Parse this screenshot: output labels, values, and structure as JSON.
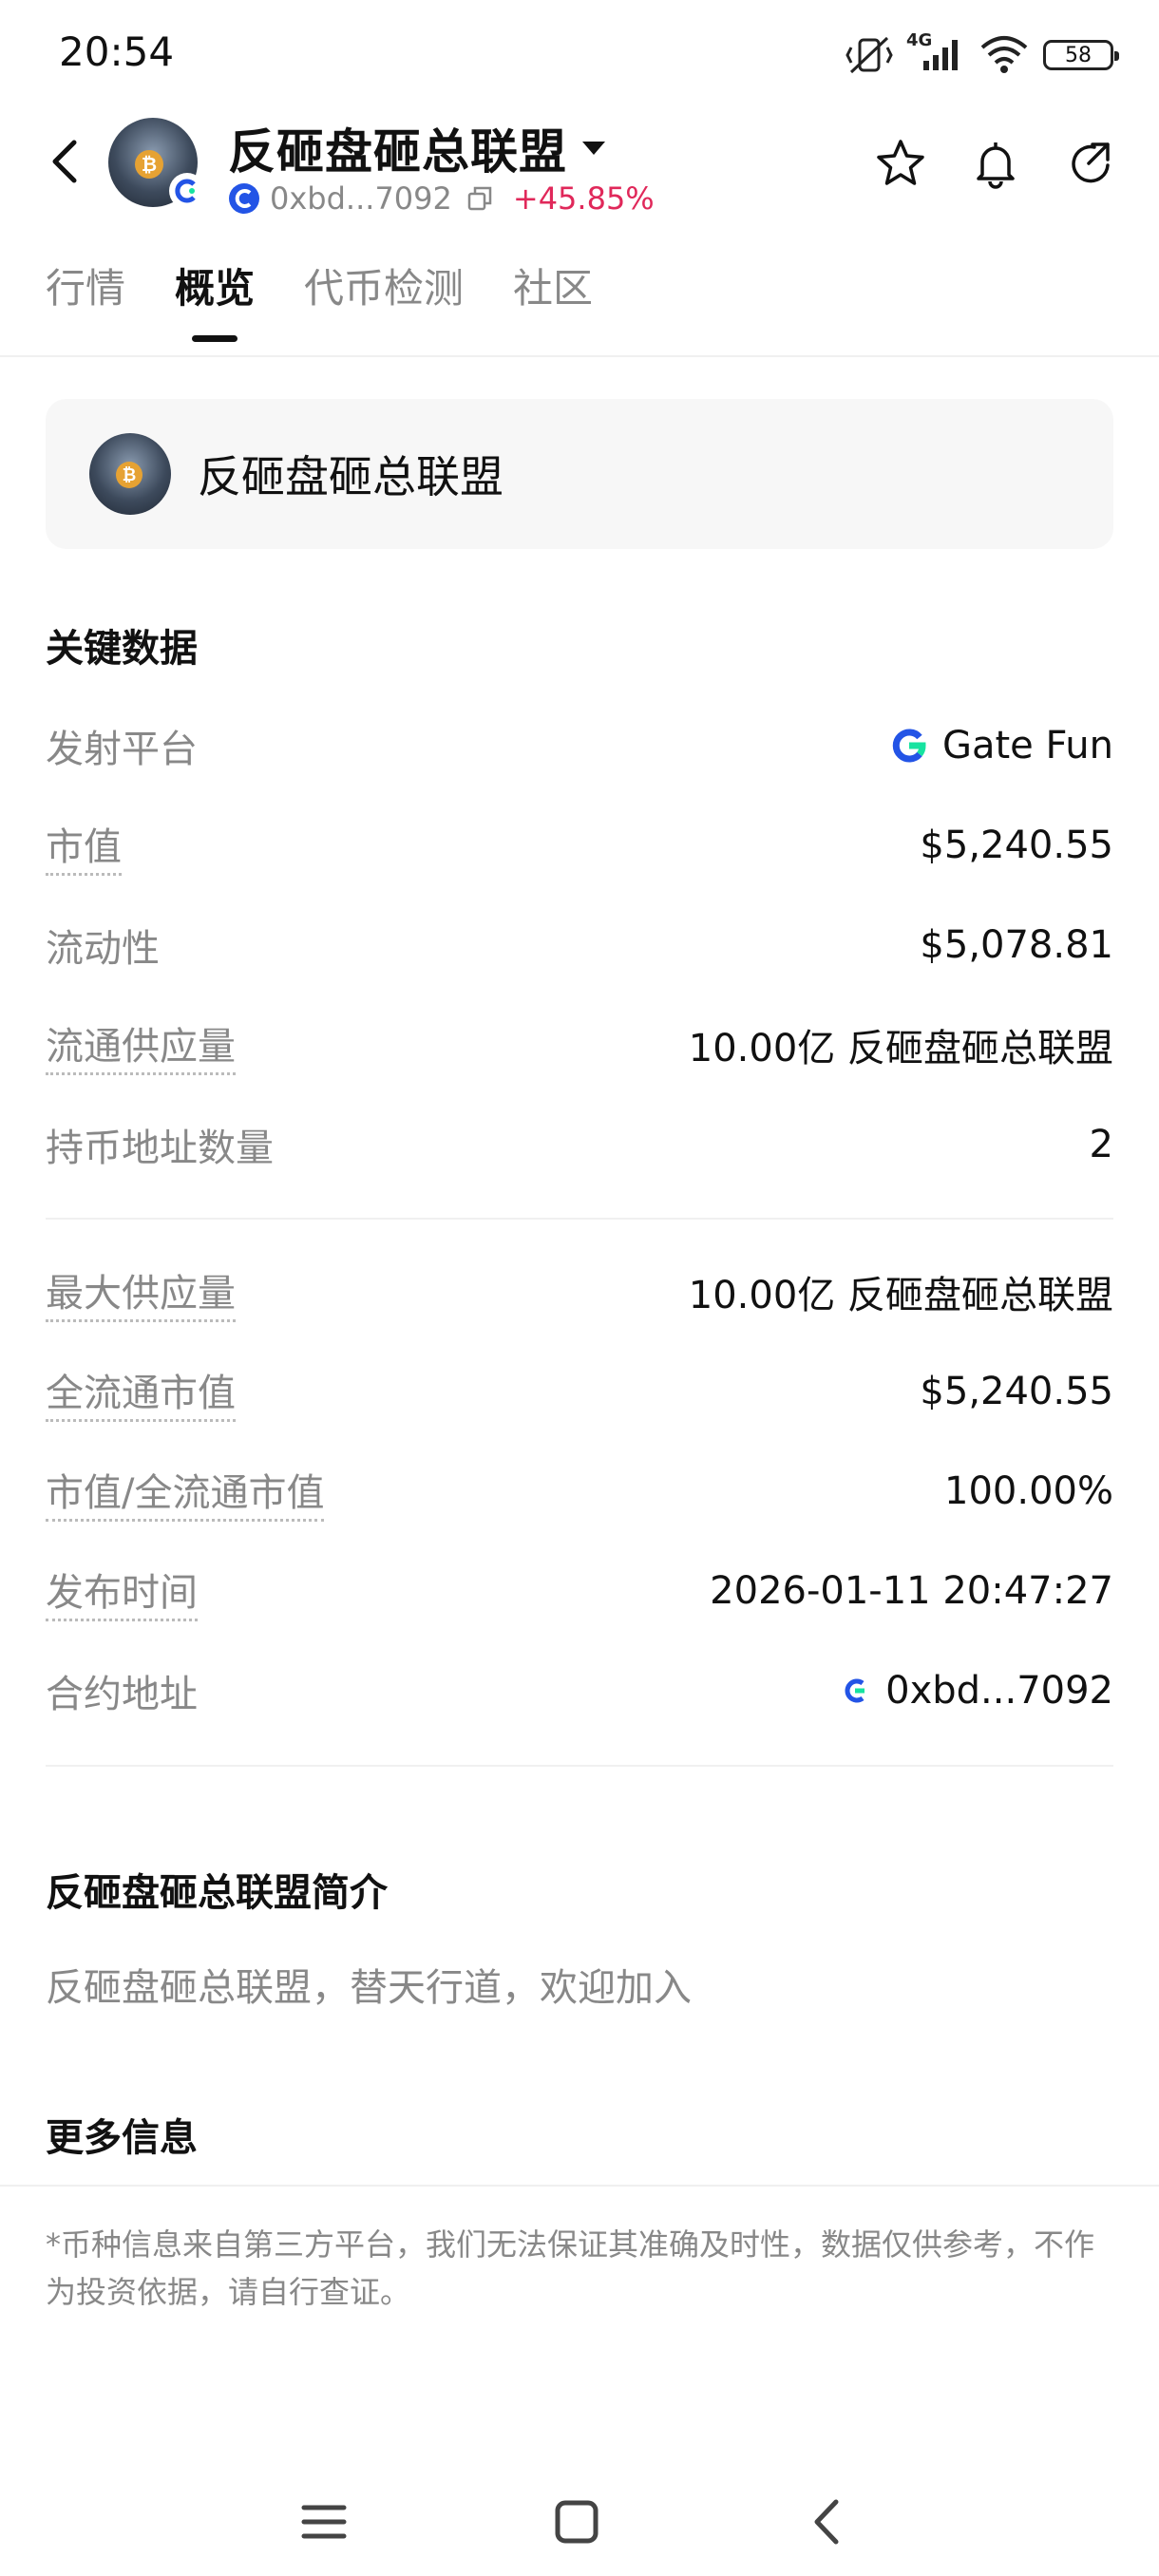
{
  "status_bar": {
    "time": "20:54",
    "network": "4G",
    "battery": "58"
  },
  "header": {
    "title": "反砸盘砸总联盟",
    "address": "0xbd...7092",
    "change": "+45.85%"
  },
  "tabs": [
    {
      "label": "行情"
    },
    {
      "label": "概览"
    },
    {
      "label": "代币检测"
    },
    {
      "label": "社区"
    }
  ],
  "token_card": {
    "name": "反砸盘砸总联盟"
  },
  "key_data": {
    "title": "关键数据",
    "rows": [
      {
        "label": "发射平台",
        "value": "Gate Fun"
      },
      {
        "label": "市值",
        "value": "$5,240.55"
      },
      {
        "label": "流动性",
        "value": "$5,078.81"
      },
      {
        "label": "流通供应量",
        "value": "10.00亿 反砸盘砸总联盟"
      },
      {
        "label": "持币地址数量",
        "value": "2"
      },
      {
        "label": "最大供应量",
        "value": "10.00亿 反砸盘砸总联盟"
      },
      {
        "label": "全流通市值",
        "value": "$5,240.55"
      },
      {
        "label": "市值/全流通市值",
        "value": "100.00%"
      },
      {
        "label": "发布时间",
        "value": "2026-01-11 20:47:27"
      },
      {
        "label": "合约地址",
        "value": "0xbd...7092"
      }
    ]
  },
  "intro": {
    "title": "反砸盘砸总联盟简介",
    "text": "反砸盘砸总联盟，替天行道，欢迎加入"
  },
  "more_info": {
    "title": "更多信息"
  },
  "disclaimer": "*币种信息来自第三方平台，我们无法保证其准确及时性，数据仅供参考，不作为投资依据，请自行查证。",
  "colors": {
    "positive": "#e0285a",
    "gate_blue": "#2354e6",
    "gate_green": "#17e3a0"
  }
}
